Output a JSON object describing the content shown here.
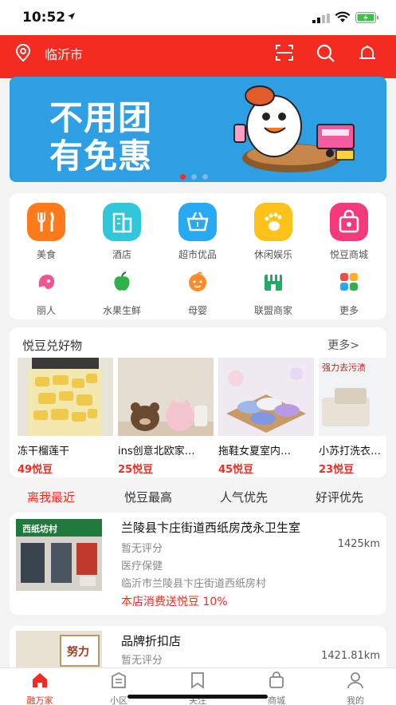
{
  "status": {
    "time": "10:52"
  },
  "topbar": {
    "city": "临沂市"
  },
  "banner": {
    "line1": "不用团",
    "line2": "有免惠"
  },
  "categories": [
    {
      "label": "美食",
      "color": "#ff7a1a"
    },
    {
      "label": "酒店",
      "color": "#2fc7d9"
    },
    {
      "label": "超市优品",
      "color": "#27a9f3"
    },
    {
      "label": "休闲娱乐",
      "color": "#ffc21a"
    },
    {
      "label": "悦豆商城",
      "color": "#f43a7a"
    },
    {
      "label": "丽人",
      "color": "#f2558f"
    },
    {
      "label": "水果生鲜",
      "color": "#2fb24a"
    },
    {
      "label": "母婴",
      "color": "#ff8a2a"
    },
    {
      "label": "联盟商家",
      "color": "#23a968"
    },
    {
      "label": "更多",
      "color": "#ef4a4a"
    }
  ],
  "goods": {
    "title": "悦豆兑好物",
    "more": "更多>",
    "items": [
      {
        "name": "冻干榴莲干",
        "price": "49悦豆"
      },
      {
        "name": "ins创意北欧家…",
        "price": "25悦豆"
      },
      {
        "name": "拖鞋女夏室内…",
        "price": "45悦豆"
      },
      {
        "name": "小苏打洗衣…",
        "price": "23悦豆"
      }
    ],
    "ad_text": "强力去污渍"
  },
  "tabs": [
    "离我最近",
    "悦豆最高",
    "人气优先",
    "好评优先"
  ],
  "stores": [
    {
      "name": "兰陵县卞庄街道西纸房茂永卫生室",
      "rating": "暂无评分",
      "distance": "1425km",
      "category": "医疗保健",
      "address": "临沂市兰陵县卞庄街道西纸房村",
      "promo": "本店消费送悦豆 10%",
      "sign_text": "西纸坊村"
    },
    {
      "name": "品牌折扣店",
      "rating": "暂无评分",
      "distance": "1421.81km",
      "sign_text": "努力"
    }
  ],
  "nav": [
    "融万家",
    "小区",
    "关注",
    "商城",
    "我的"
  ]
}
